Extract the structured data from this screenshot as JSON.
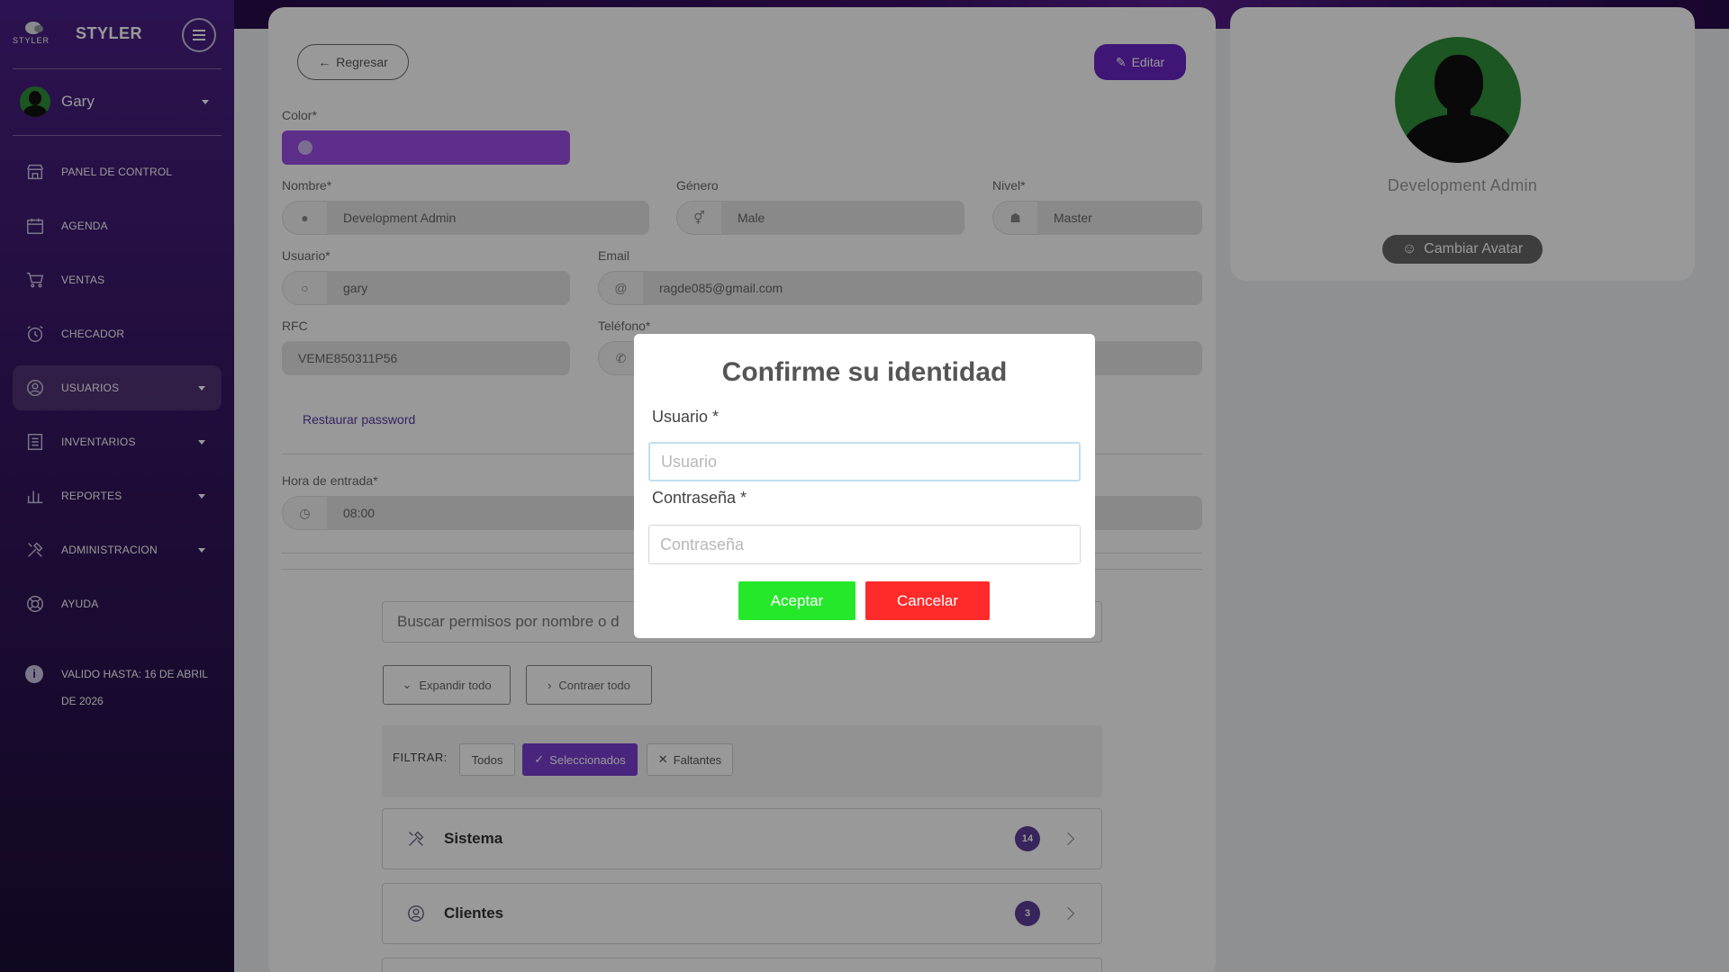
{
  "sidebar": {
    "brand_logo_text": "STYLER",
    "brand_name": "STYLER",
    "user_name": "Gary",
    "items": [
      {
        "label": "PANEL DE CONTROL",
        "icon": "store-icon",
        "has_caret": false
      },
      {
        "label": "AGENDA",
        "icon": "calendar-icon",
        "has_caret": false
      },
      {
        "label": "VENTAS",
        "icon": "cart-icon",
        "has_caret": false
      },
      {
        "label": "CHECADOR",
        "icon": "alarm-clock-icon",
        "has_caret": false
      },
      {
        "label": "USUARIOS",
        "icon": "user-circle-icon",
        "has_caret": true,
        "active": true
      },
      {
        "label": "INVENTARIOS",
        "icon": "list-icon",
        "has_caret": true
      },
      {
        "label": "REPORTES",
        "icon": "bar-chart-icon",
        "has_caret": true
      },
      {
        "label": "ADMINISTRACION",
        "icon": "tools-icon",
        "has_caret": true
      },
      {
        "label": "AYUDA",
        "icon": "lifebuoy-icon",
        "has_caret": false
      }
    ],
    "valid_until": "VALIDO HASTA: 16 DE ABRIL DE 2026"
  },
  "form": {
    "back_label": "Regresar",
    "edit_label": "Editar",
    "color_label": "Color*",
    "color_value": "#9b4de6",
    "name_label": "Nombre*",
    "name_value": "Development Admin",
    "gender_label": "Género",
    "gender_value": "Male",
    "level_label": "Nivel*",
    "level_value": "Master",
    "user_label": "Usuario*",
    "user_value": "gary",
    "email_label": "Email",
    "email_value": "ragde085@gmail.com",
    "rfc_label": "RFC",
    "rfc_value": "VEME850311P56",
    "phone_label": "Teléfono*",
    "restore_label": "Restaurar password",
    "entry_label": "Hora de entrada*",
    "entry_value": "08:00"
  },
  "permissions": {
    "search_placeholder": "Buscar permisos por nombre o d",
    "expand_label": "Expandir todo",
    "collapse_label": "Contraer todo",
    "filter_label": "FILTRAR:",
    "filters": [
      {
        "label": "Todos",
        "selected": false
      },
      {
        "label": "Seleccionados",
        "selected": true
      },
      {
        "label": "Faltantes",
        "selected": false
      }
    ],
    "groups": [
      {
        "title": "Sistema",
        "count": "14",
        "icon": "tools-icon"
      },
      {
        "title": "Clientes",
        "count": "3",
        "icon": "user-circle-icon"
      }
    ]
  },
  "profile": {
    "name": "Development Admin",
    "change_avatar_label": "Cambiar Avatar"
  },
  "modal": {
    "title": "Confirme su identidad",
    "user_label": "Usuario *",
    "user_placeholder": "Usuario",
    "password_label": "Contraseña *",
    "password_placeholder": "Contraseña",
    "accept_label": "Aceptar",
    "cancel_label": "Cancelar"
  },
  "colors": {
    "accent": "#6a25c4",
    "accept": "#25e82b",
    "cancel": "#ff2a2a",
    "sidebar": "#3a1868"
  }
}
